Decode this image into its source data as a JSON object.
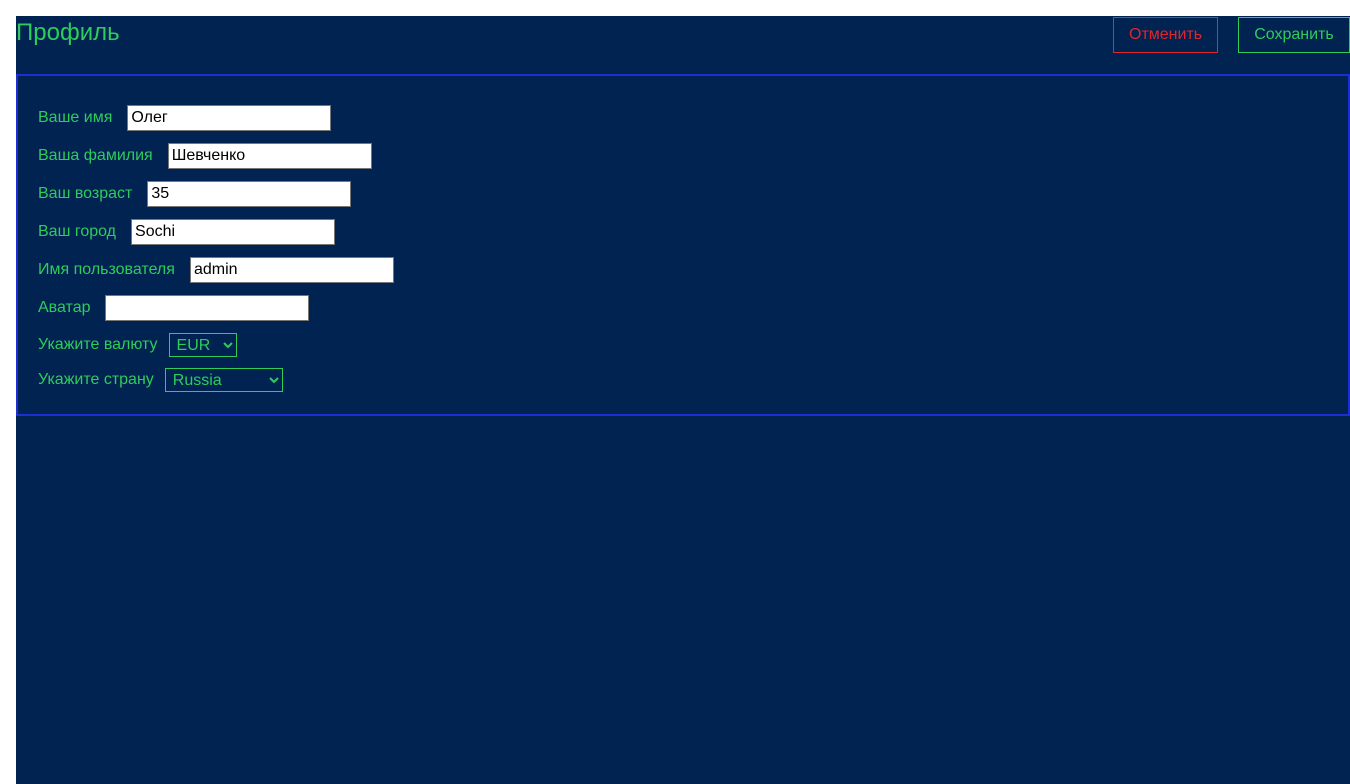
{
  "header": {
    "title": "Профиль",
    "cancel_label": "Отменить",
    "save_label": "Сохранить"
  },
  "form": {
    "first_name": {
      "label": "Ваше имя",
      "value": "Олег"
    },
    "last_name": {
      "label": "Ваша фамилия",
      "value": "Шевченко"
    },
    "age": {
      "label": "Ваш возраст",
      "value": "35"
    },
    "city": {
      "label": "Ваш город",
      "value": "Sochi"
    },
    "username": {
      "label": "Имя пользователя",
      "value": "admin"
    },
    "avatar": {
      "label": "Аватар",
      "value": ""
    },
    "currency": {
      "label": "Укажите валюту",
      "selected": "EUR"
    },
    "country": {
      "label": "Укажите страну",
      "selected": "Russia"
    }
  },
  "colors": {
    "background": "#002352",
    "accent_green": "#2ecc5c",
    "cancel_red": "#e0262b",
    "panel_border": "#1c2fd6"
  }
}
